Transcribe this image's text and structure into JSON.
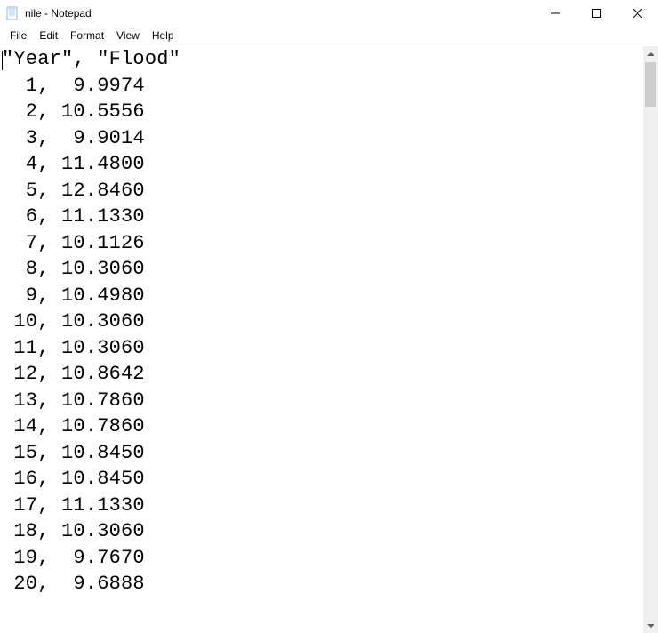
{
  "titlebar": {
    "title": "nile - Notepad"
  },
  "menu": {
    "items": [
      "File",
      "Edit",
      "Format",
      "View",
      "Help"
    ]
  },
  "content": {
    "header_line": "\"Year\", \"Flood\"",
    "rows": [
      {
        "year": " 1",
        "flood": " 9.9974"
      },
      {
        "year": " 2",
        "flood": "10.5556"
      },
      {
        "year": " 3",
        "flood": " 9.9014"
      },
      {
        "year": " 4",
        "flood": "11.4800"
      },
      {
        "year": " 5",
        "flood": "12.8460"
      },
      {
        "year": " 6",
        "flood": "11.1330"
      },
      {
        "year": " 7",
        "flood": "10.1126"
      },
      {
        "year": " 8",
        "flood": "10.3060"
      },
      {
        "year": " 9",
        "flood": "10.4980"
      },
      {
        "year": "10",
        "flood": "10.3060"
      },
      {
        "year": "11",
        "flood": "10.3060"
      },
      {
        "year": "12",
        "flood": "10.8642"
      },
      {
        "year": "13",
        "flood": "10.7860"
      },
      {
        "year": "14",
        "flood": "10.7860"
      },
      {
        "year": "15",
        "flood": "10.8450"
      },
      {
        "year": "16",
        "flood": "10.8450"
      },
      {
        "year": "17",
        "flood": "11.1330"
      },
      {
        "year": "18",
        "flood": "10.3060"
      },
      {
        "year": "19",
        "flood": " 9.7670"
      },
      {
        "year": "20",
        "flood": " 9.6888"
      }
    ]
  }
}
